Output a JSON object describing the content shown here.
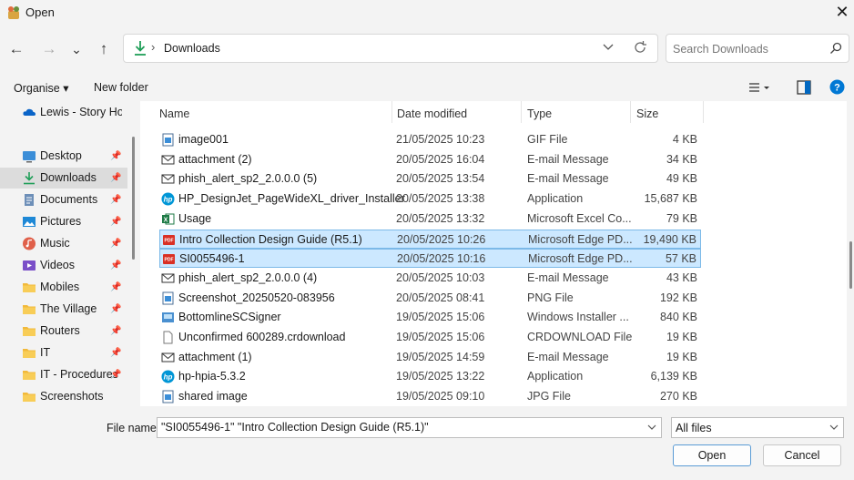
{
  "window": {
    "title": "Open",
    "close": "✕"
  },
  "nav": {
    "back": "←",
    "forward": "→",
    "recent": "⌄",
    "up": "↑"
  },
  "address": {
    "separator": "›",
    "path": "Downloads"
  },
  "search": {
    "placeholder": "Search Downloads"
  },
  "toolbar": {
    "organise": "Organise ▾",
    "new_folder": "New folder"
  },
  "sidebar": {
    "items": [
      {
        "label": "Lewis - Story Homes",
        "icon": "onedrive-icon",
        "pinned": false
      },
      {
        "label": "Desktop",
        "icon": "desktop-icon",
        "pinned": true
      },
      {
        "label": "Downloads",
        "icon": "download-icon",
        "pinned": true,
        "selected": true
      },
      {
        "label": "Documents",
        "icon": "documents-icon",
        "pinned": true
      },
      {
        "label": "Pictures",
        "icon": "pictures-icon",
        "pinned": true
      },
      {
        "label": "Music",
        "icon": "music-icon",
        "pinned": true
      },
      {
        "label": "Videos",
        "icon": "videos-icon",
        "pinned": true
      },
      {
        "label": "Mobiles",
        "icon": "folder-icon",
        "pinned": true
      },
      {
        "label": "The Village",
        "icon": "folder-icon",
        "pinned": true
      },
      {
        "label": "Routers",
        "icon": "folder-icon",
        "pinned": true
      },
      {
        "label": "IT",
        "icon": "folder-icon",
        "pinned": true
      },
      {
        "label": "IT - Procedures",
        "icon": "folder-icon",
        "pinned": true
      },
      {
        "label": "Screenshots",
        "icon": "folder-icon",
        "pinned": false
      }
    ]
  },
  "columns": {
    "name": "Name",
    "date": "Date modified",
    "type": "Type",
    "size": "Size"
  },
  "files": [
    {
      "name": "image001",
      "date": "21/05/2025 10:23",
      "type": "GIF File",
      "size": "4 KB",
      "icon": "image-file-icon"
    },
    {
      "name": "attachment (2)",
      "date": "20/05/2025 16:04",
      "type": "E-mail Message",
      "size": "34 KB",
      "icon": "email-icon"
    },
    {
      "name": "phish_alert_sp2_2.0.0.0 (5)",
      "date": "20/05/2025 13:54",
      "type": "E-mail Message",
      "size": "49 KB",
      "icon": "email-icon"
    },
    {
      "name": "HP_DesignJet_PageWideXL_driver_Installer",
      "date": "20/05/2025 13:38",
      "type": "Application",
      "size": "15,687 KB",
      "icon": "hp-icon"
    },
    {
      "name": "Usage",
      "date": "20/05/2025 13:32",
      "type": "Microsoft Excel Co...",
      "size": "79 KB",
      "icon": "excel-icon"
    },
    {
      "name": "Intro Collection Design Guide (R5.1)",
      "date": "20/05/2025 10:26",
      "type": "Microsoft Edge PD...",
      "size": "19,490 KB",
      "icon": "pdf-icon",
      "selected": true
    },
    {
      "name": "SI0055496-1",
      "date": "20/05/2025 10:16",
      "type": "Microsoft Edge PD...",
      "size": "57 KB",
      "icon": "pdf-icon",
      "selected": true
    },
    {
      "name": "phish_alert_sp2_2.0.0.0 (4)",
      "date": "20/05/2025 10:03",
      "type": "E-mail Message",
      "size": "43 KB",
      "icon": "email-icon"
    },
    {
      "name": "Screenshot_20250520-083956",
      "date": "20/05/2025 08:41",
      "type": "PNG File",
      "size": "192 KB",
      "icon": "image-file-icon"
    },
    {
      "name": "BottomlineSCSigner",
      "date": "19/05/2025 15:06",
      "type": "Windows Installer ...",
      "size": "840 KB",
      "icon": "installer-icon"
    },
    {
      "name": "Unconfirmed 600289.crdownload",
      "date": "19/05/2025 15:06",
      "type": "CRDOWNLOAD File",
      "size": "19 KB",
      "icon": "blank-file-icon"
    },
    {
      "name": "attachment (1)",
      "date": "19/05/2025 14:59",
      "type": "E-mail Message",
      "size": "19 KB",
      "icon": "email-icon"
    },
    {
      "name": "hp-hpia-5.3.2",
      "date": "19/05/2025 13:22",
      "type": "Application",
      "size": "6,139 KB",
      "icon": "hp-icon"
    },
    {
      "name": "shared image",
      "date": "19/05/2025 09:10",
      "type": "JPG File",
      "size": "270 KB",
      "icon": "image-file-icon"
    }
  ],
  "footer": {
    "filename_label": "File name:",
    "filename_value": "\"SI0055496-1\" \"Intro Collection Design Guide (R5.1)\"",
    "filter": "All files",
    "open": "Open",
    "cancel": "Cancel"
  },
  "colors": {
    "selection_bg": "#cce8ff",
    "selection_border": "#7cb9e8",
    "accent": "#0067c0",
    "help": "#0078d4"
  }
}
